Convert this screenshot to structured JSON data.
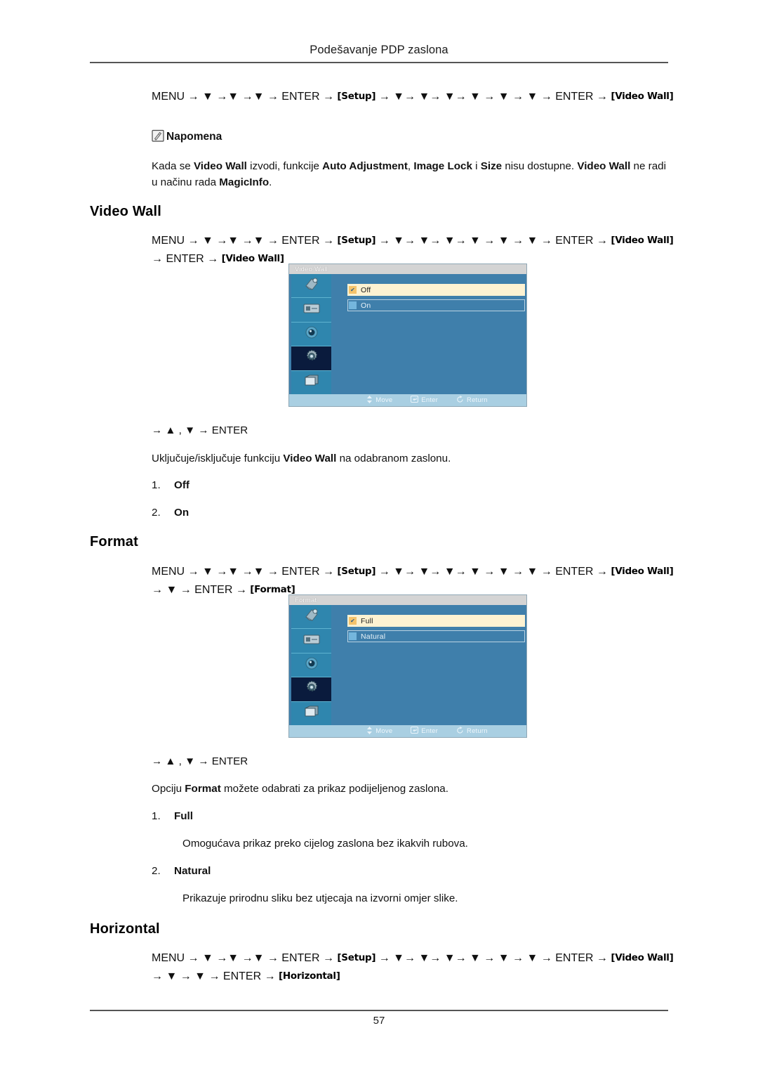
{
  "header": {
    "title": "Podešavanje PDP zaslona"
  },
  "footer": {
    "page_number": "57"
  },
  "intro": {
    "path_line1": "MENU → ▼ →▼ →▼ → ENTER →",
    "path_setup": "Setup",
    "path_line2": "→ ▼→ ▼→ ▼→ ▼ → ▼ → ▼ → ENTER →",
    "path_videowall": "Video Wall"
  },
  "note": {
    "icon": "note-pencil-icon",
    "title": "Napomena",
    "text_parts": {
      "p1": "Kada se ",
      "b1": "Video Wall",
      "p2": " izvodi, funkcije ",
      "b2": "Auto Adjustment",
      "p3": ", ",
      "b3": "Image Lock",
      "p4": " i ",
      "b4": "Size",
      "p5": " nisu dostupne. ",
      "b5": "Video Wall",
      "p6": " ne radi u načinu rada ",
      "b6": "MagicInfo",
      "p7": "."
    }
  },
  "sections": [
    {
      "id": "video-wall",
      "title": "Video Wall",
      "path": {
        "line1": "MENU → ▼ →▼ →▼ → ENTER →",
        "setup": "Setup",
        "mid": "→ ▼→ ▼→ ▼→ ▼ → ▼ → ▼ → ENTER →",
        "tag1": "Video Wall",
        "after1": "→ ENTER →",
        "tag2": "Video Wall"
      },
      "osd": {
        "title": "Video Wall",
        "options": [
          {
            "label": "Off",
            "selected": true
          },
          {
            "label": "On",
            "selected": false
          }
        ],
        "footer": [
          {
            "icon": "move-icon",
            "label": "Move"
          },
          {
            "icon": "enter-icon",
            "label": "Enter"
          },
          {
            "icon": "return-icon",
            "label": "Return"
          }
        ]
      },
      "nav_hint": "→ ▲ , ▼ → ENTER",
      "description": {
        "p1": "Uključuje/isključuje funkciju ",
        "b1": "Video Wall",
        "p2": " na odabranom zaslonu."
      },
      "items": [
        {
          "index": "1.",
          "name": "Off",
          "desc": ""
        },
        {
          "index": "2.",
          "name": "On",
          "desc": ""
        }
      ]
    },
    {
      "id": "format",
      "title": "Format",
      "path": {
        "line1": "MENU → ▼ →▼ →▼ → ENTER →",
        "setup": "Setup",
        "mid": "→ ▼→ ▼→ ▼→ ▼ → ▼ → ▼ → ENTER →",
        "tag1": "Video Wall",
        "after1": "→ ▼ → ENTER →",
        "tag2": "Format"
      },
      "osd": {
        "title": "Format",
        "options": [
          {
            "label": "Full",
            "selected": true
          },
          {
            "label": "Natural",
            "selected": false
          }
        ],
        "footer": [
          {
            "icon": "move-icon",
            "label": "Move"
          },
          {
            "icon": "enter-icon",
            "label": "Enter"
          },
          {
            "icon": "return-icon",
            "label": "Return"
          }
        ]
      },
      "nav_hint": "→ ▲ , ▼ → ENTER",
      "description": {
        "p1": "Opciju ",
        "b1": "Format",
        "p2": " možete odabrati za prikaz podijeljenog zaslona."
      },
      "items": [
        {
          "index": "1.",
          "name": "Full",
          "desc": "Omogućava prikaz preko cijelog zaslona bez ikakvih rubova."
        },
        {
          "index": "2.",
          "name": "Natural",
          "desc": "Prikazuje prirodnu sliku bez utjecaja na izvorni omjer slike."
        }
      ]
    },
    {
      "id": "horizontal",
      "title": "Horizontal",
      "path": {
        "line1": "MENU → ▼ →▼ →▼ → ENTER →",
        "setup": "Setup",
        "mid": "→ ▼→ ▼→ ▼→ ▼ → ▼ → ▼ → ENTER →",
        "tag1": "Video Wall",
        "after1": "→ ▼ → ▼ → ENTER →",
        "tag2": "Horizontal"
      }
    }
  ],
  "colors": {
    "osd_background": "#3f7fab",
    "osd_sidebar": "#2f86ae",
    "osd_sidebar_selected": "#0a1b3d",
    "osd_titlebar": "#d4d4d4",
    "osd_footer": "#a9cfe2",
    "selected_row": "#fdf2d2",
    "checkbox_selected": "#f5c36b",
    "checkbox_unselected": "#74b6dd",
    "rule": "#555555"
  }
}
